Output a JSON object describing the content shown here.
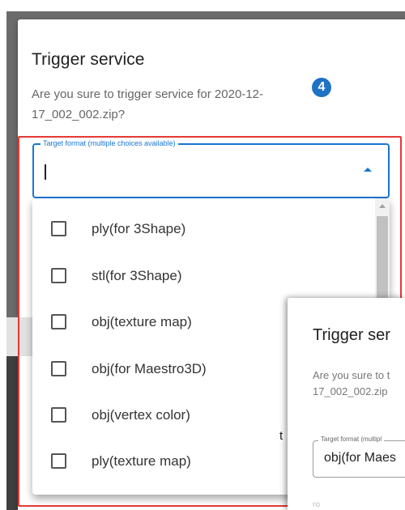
{
  "dialog": {
    "title": "Trigger service",
    "message": "Are you sure to trigger service for 2020-12-17_002_002.zip?",
    "step_badge": "4",
    "select": {
      "label": "Target format (multiple choices available)",
      "value": ""
    },
    "options": [
      {
        "label": "ply(for 3Shape)",
        "checked": false
      },
      {
        "label": "stl(for 3Shape)",
        "checked": false
      },
      {
        "label": "obj(texture map)",
        "checked": false
      },
      {
        "label": "obj(for Maestro3D)",
        "checked": false
      },
      {
        "label": "obj(vertex color)",
        "checked": false
      },
      {
        "label": "ply(texture map)",
        "checked": false
      }
    ]
  },
  "background_glyph": "t",
  "dialog2": {
    "title": "Trigger ser",
    "message_line1": "Are you sure to t",
    "message_line2": "17_002_002.zip",
    "select_label": "Target format (multipl",
    "select_value": "obj(for Maes",
    "bottom_fragment": "ro"
  },
  "colors": {
    "accent": "#1976d2",
    "highlight": "#e53935",
    "badge": "#1f72c4"
  }
}
